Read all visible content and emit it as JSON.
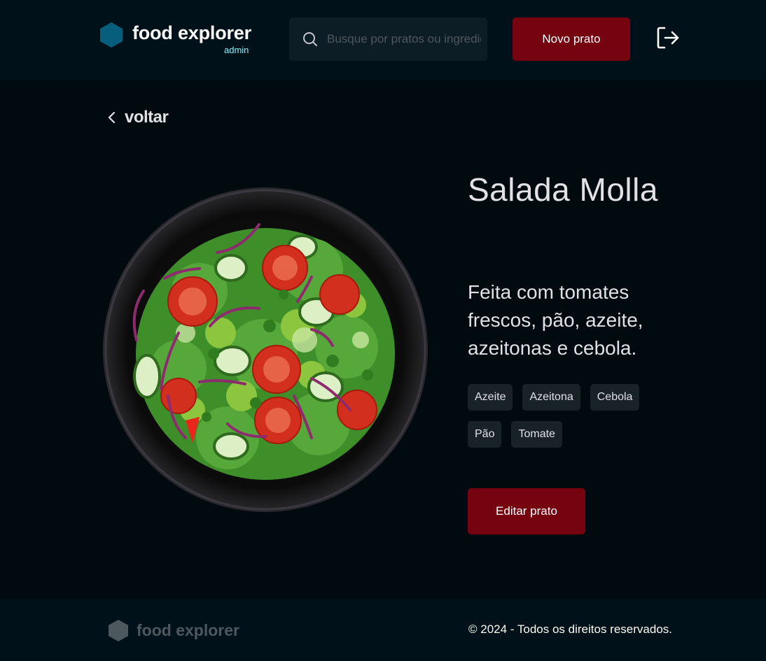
{
  "header": {
    "brand_name": "food explorer",
    "brand_sub": "admin",
    "search_placeholder": "Busque por pratos ou ingredientes",
    "new_dish_label": "Novo prato",
    "icons": [
      "hexagon-logo-icon",
      "search-icon",
      "logout-icon"
    ]
  },
  "nav": {
    "back_label": "voltar"
  },
  "dish": {
    "title": "Salada Molla",
    "description": "Feita com tomates frescos, pão, azeite, azeitonas e cebola.",
    "ingredients": [
      "Azeite",
      "Azeitona",
      "Cebola",
      "Pão",
      "Tomate"
    ],
    "edit_label": "Editar prato"
  },
  "footer": {
    "brand_name": "food explorer",
    "copyright": "© 2024 - Todos os direitos reservados."
  },
  "colors": {
    "background": "#000A0F",
    "header_bg": "#00111A",
    "accent_red": "#750310",
    "brand_hex": "#065E7C",
    "admin_cyan": "#82F3FF",
    "tag_bg": "#192227"
  }
}
